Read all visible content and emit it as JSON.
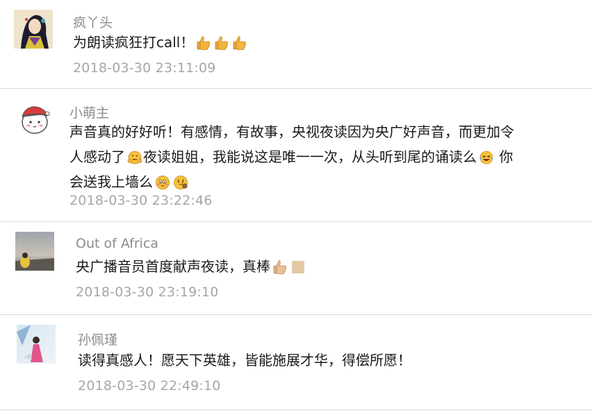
{
  "comments": [
    {
      "name": "疯丫头",
      "text": "为朗读疯狂打call！",
      "time": "2018-03-30 23:11:09"
    },
    {
      "name": "小萌主",
      "line1": "声音真的好好听！有感情，有故事，央视夜读因为央广好声音，而更加令",
      "line2a": "人感动了",
      "line2b": "夜读姐姐，我能说这是唯一一次，从头听到尾的诵读么",
      "line2c": " 你",
      "line3": "会送我上墙么",
      "time": "2018-03-30 23:22:46"
    },
    {
      "name": "Out of Africa",
      "text": "央广播音员首度献声夜读，真棒",
      "time": "2018-03-30 23:19:10"
    },
    {
      "name": "孙佩瑾",
      "text": "读得真感人！愿天下英雄，皆能施展才华，得偿所愿！",
      "time": "2018-03-30 22:49:10"
    }
  ],
  "icons": {
    "thumbs_up": "thumbs-up-icon",
    "hug": "hug-icon",
    "laughing_tears": "laughing-tears-icon",
    "blushing": "blushing-icon",
    "thinking": "thinking-icon",
    "skin_tone": "skin-tone-swatch-icon"
  }
}
